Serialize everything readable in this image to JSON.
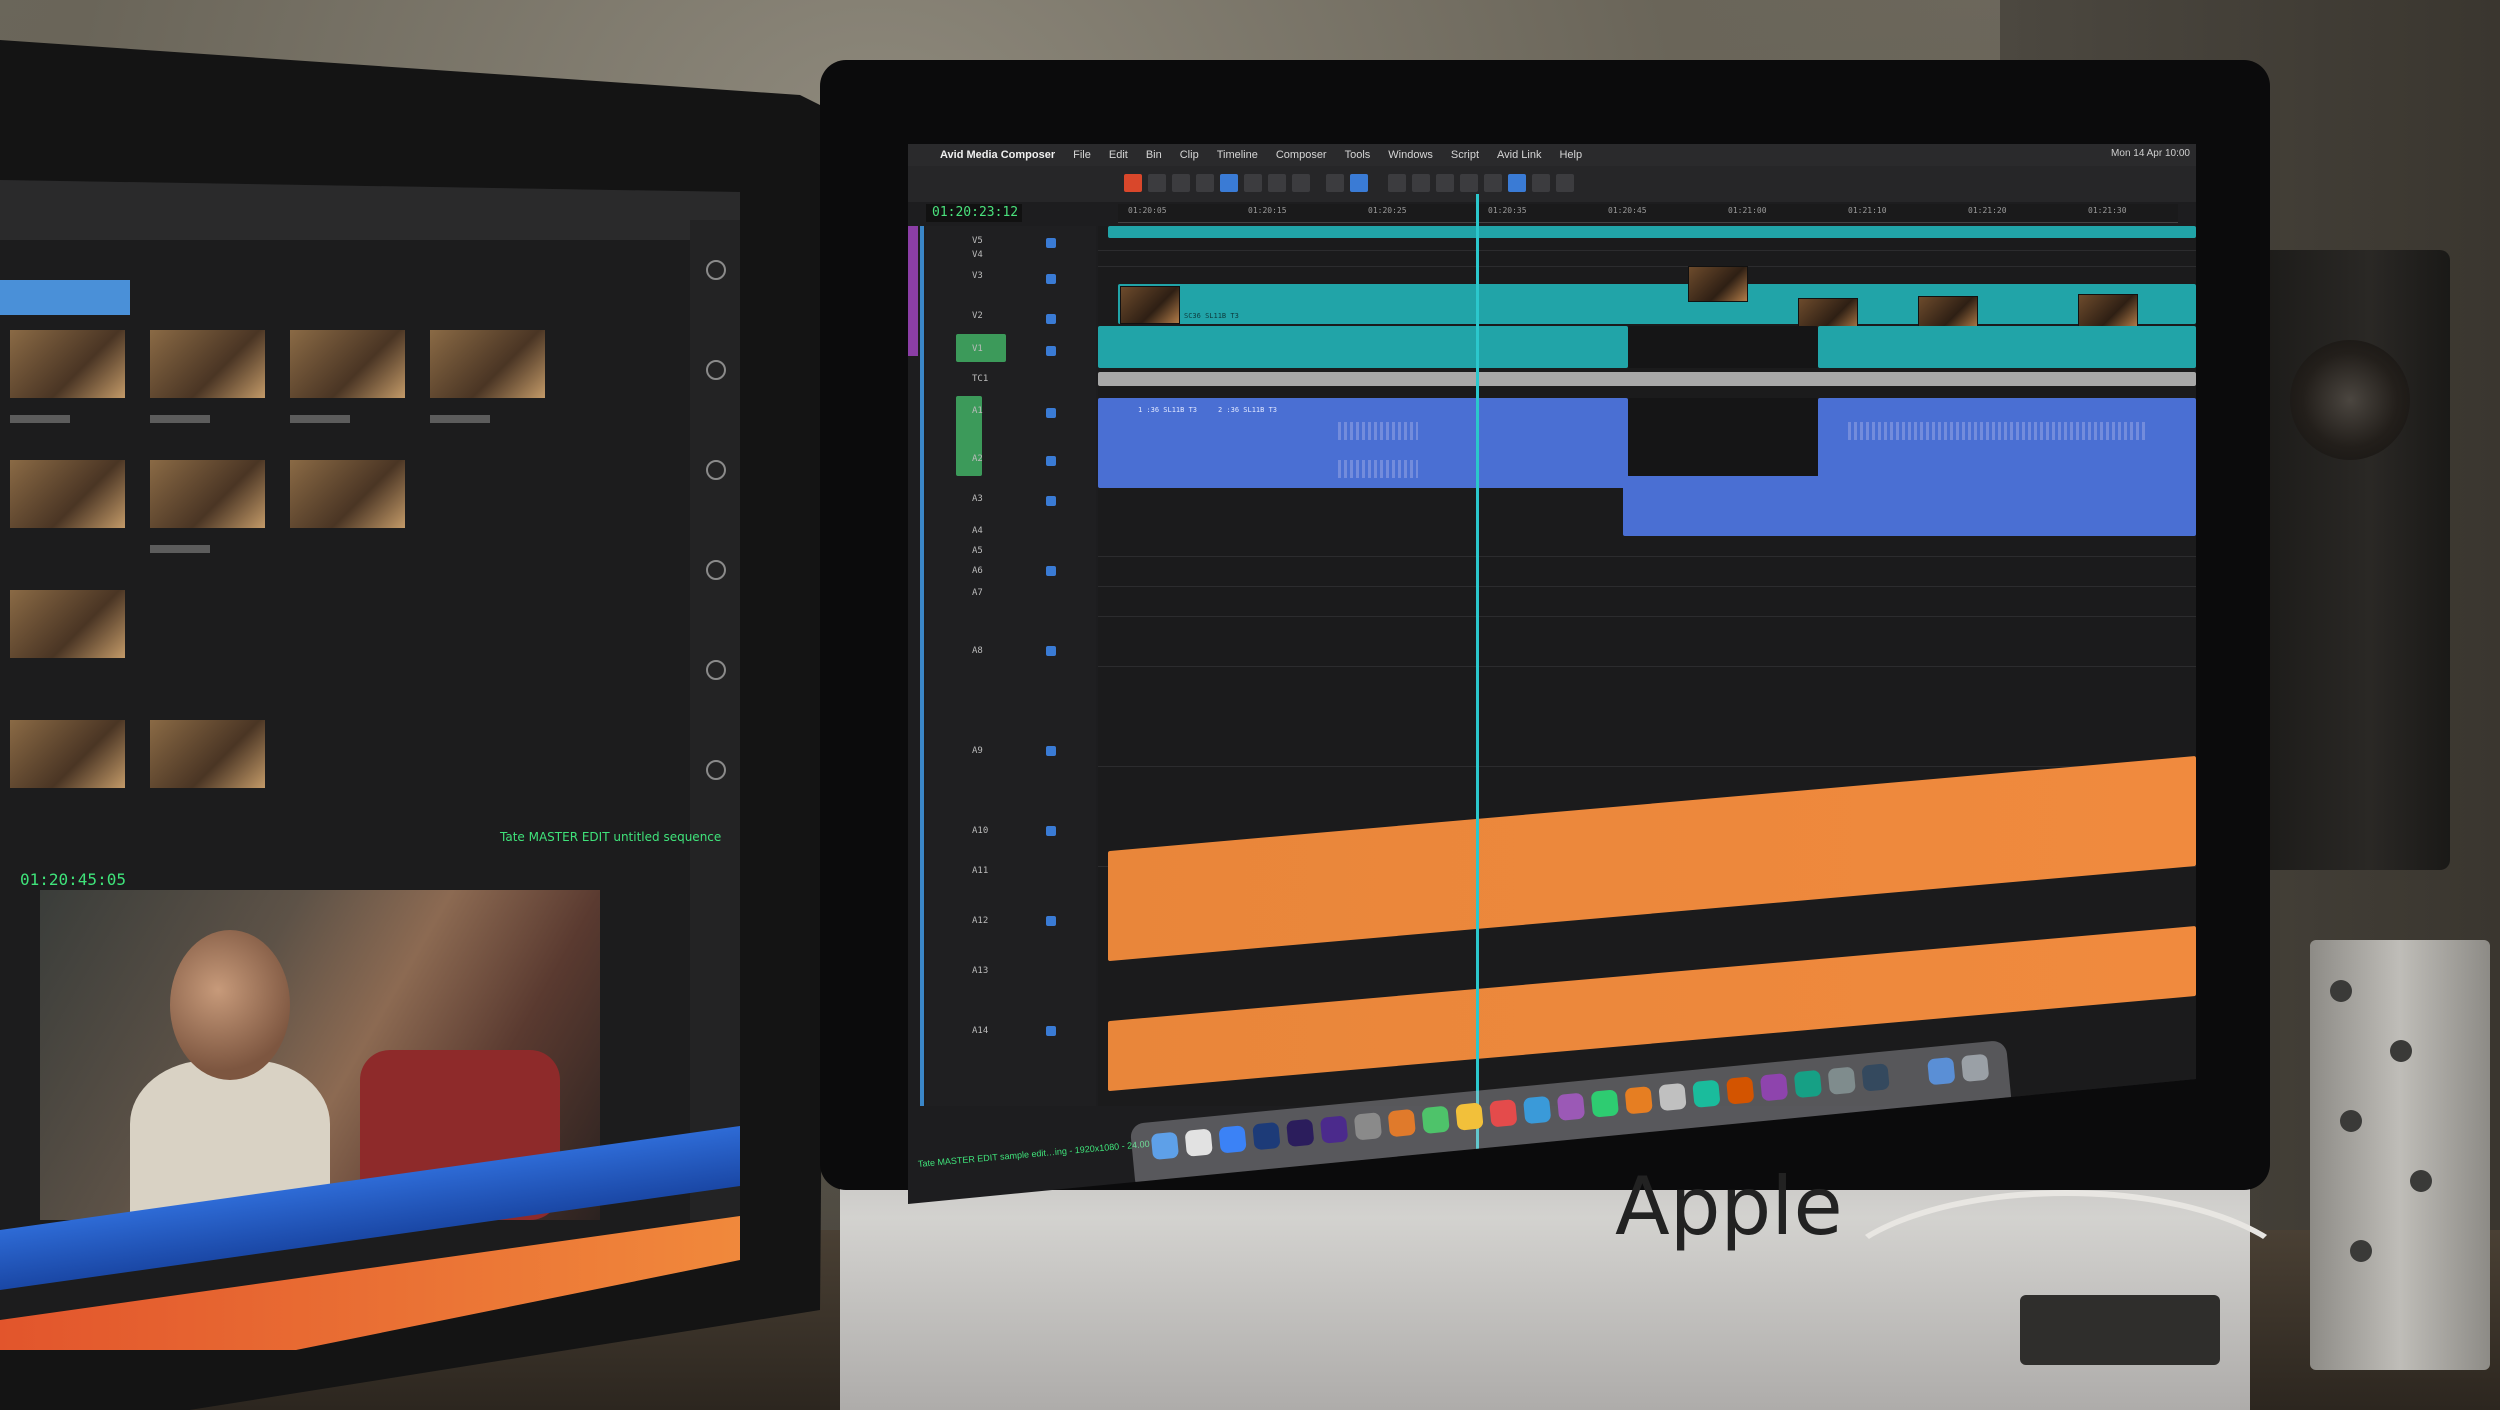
{
  "imac": {
    "menubar": {
      "app_name": "Avid Media Composer",
      "menus": [
        "File",
        "Edit",
        "Bin",
        "Clip",
        "Timeline",
        "Composer",
        "Tools",
        "Windows",
        "Script",
        "Avid Link",
        "Help"
      ],
      "clock": "Mon 14 Apr 10:00"
    },
    "timecode": "01:20:23:12",
    "ruler_ticks": [
      "01:20:05",
      "01:20:15",
      "01:20:25",
      "01:20:35",
      "01:20:45",
      "01:21:00",
      "01:21:10",
      "01:21:20",
      "01:21:30"
    ],
    "tracks": {
      "video": [
        "V5",
        "V4",
        "V3",
        "V2",
        "V1"
      ],
      "timecode": "TC1",
      "audio": [
        "A1",
        "A2",
        "A3",
        "A4",
        "A5",
        "A6",
        "A7",
        "A8",
        "A9",
        "A10",
        "A11",
        "A12",
        "A13",
        "A14"
      ]
    },
    "clips": {
      "v2_name": "SC36 SL11B T3",
      "a1_name_a": "1 :36 SL11B T3",
      "a1_name_b": "2 :36 SL11B T3"
    },
    "status_bar": "Tate MASTER EDIT  sample edit…ing - 1920x1080 - 24.00 fps",
    "brand": "Apple"
  },
  "left_monitor": {
    "timecode": "01:20:45:05",
    "status": "Tate MASTER EDIT  untitled sequence"
  }
}
